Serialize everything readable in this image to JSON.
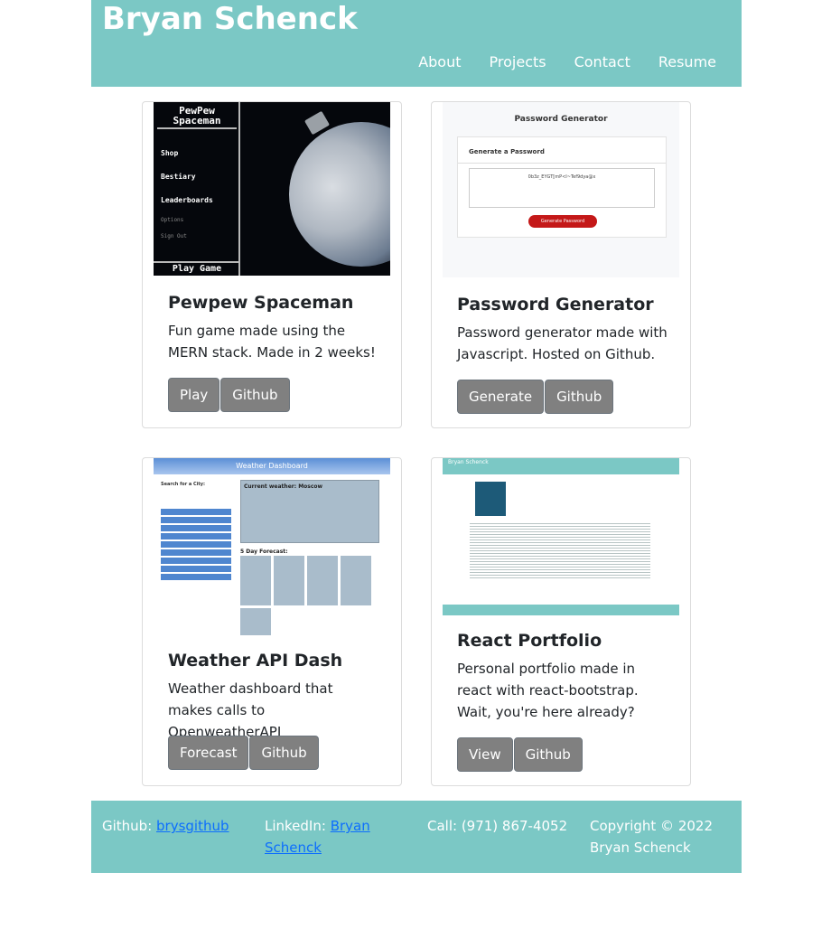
{
  "header": {
    "title": "Bryan Schenck",
    "nav": [
      "About",
      "Projects",
      "Contact",
      "Resume"
    ]
  },
  "projects": [
    {
      "title": "Pewpew Spaceman",
      "description": "Fun game made using the MERN stack. Made in 2 weeks!",
      "buttons": [
        "Play",
        "Github"
      ],
      "thumb": {
        "logo_line1": "PewPew",
        "logo_line2": "Spaceman",
        "menu": [
          "Shop",
          "Bestiary",
          "Leaderboards"
        ],
        "menu_dim": [
          "Options",
          "Sign Out"
        ],
        "play": "Play Game"
      }
    },
    {
      "title": "Password Generator",
      "description": "Password generator made with Javascript. Hosted on Github.",
      "buttons": [
        "Generate",
        "Github"
      ],
      "thumb": {
        "heading": "Password Generator",
        "subheading": "Generate a Password",
        "password": "0b3z_EYGT[mP<I~Tef9dya@x",
        "button": "Generate Password"
      }
    },
    {
      "title": "Weather API Dash",
      "description": "Weather dashboard that makes calls to OpenweatherAPI",
      "buttons": [
        "Forecast",
        "Github"
      ],
      "thumb": {
        "heading": "Weather Dashboard",
        "search_label": "Search for a City:",
        "current": "Current weather: Moscow",
        "forecast": "5 Day Forecast:"
      }
    },
    {
      "title": "React Portfolio",
      "description": "Personal portfolio made in react with react-bootstrap. Wait, you're here already?",
      "buttons": [
        "View",
        "Github"
      ],
      "thumb": {
        "heading": "Bryan Schenck"
      }
    }
  ],
  "footer": {
    "github_label": "Github: ",
    "github_link": "brysgithub",
    "linkedin_label": "LinkedIn: ",
    "linkedin_link": "Bryan Schenck",
    "call": "Call: (971) 867-4052",
    "copyright": "Copyright © 2022 Bryan Schenck"
  },
  "colors": {
    "header_bg": "#7bc8c5",
    "button_bg": "#808080",
    "link": "#0d6efd"
  }
}
